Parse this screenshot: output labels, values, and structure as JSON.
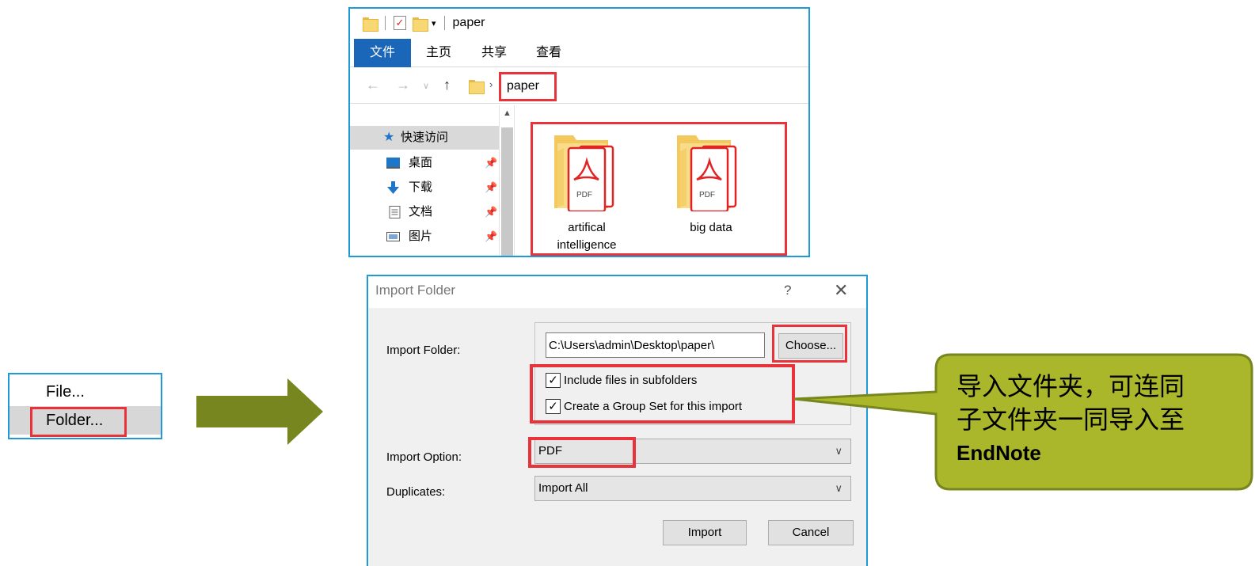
{
  "file_menu": {
    "items": [
      {
        "label": "File..."
      },
      {
        "label": "Folder..."
      }
    ]
  },
  "explorer": {
    "title": "paper",
    "ribbon_tabs": [
      "文件",
      "主页",
      "共享",
      "查看"
    ],
    "address": "paper",
    "sidebar": [
      {
        "label": "快速访问",
        "icon": "star-icon"
      },
      {
        "label": "桌面",
        "icon": "desktop-icon"
      },
      {
        "label": "下载",
        "icon": "download-icon"
      },
      {
        "label": "文档",
        "icon": "document-icon"
      },
      {
        "label": "图片",
        "icon": "picture-icon"
      }
    ],
    "folders": [
      {
        "name_line1": "artifical",
        "name_line2": "intelligence"
      },
      {
        "name_line1": "big data",
        "name_line2": ""
      }
    ]
  },
  "dialog": {
    "title": "Import Folder",
    "help": "?",
    "close": "✕",
    "import_folder_label": "Import Folder:",
    "import_folder_value": "C:\\Users\\admin\\Desktop\\paper\\",
    "choose_label": "Choose...",
    "include_subfolders_label": "Include files in subfolders",
    "include_subfolders_checked": true,
    "group_set_label": "Create a Group Set for this import",
    "group_set_checked": true,
    "import_option_label": "Import Option:",
    "import_option_value": "PDF",
    "duplicates_label": "Duplicates:",
    "duplicates_value": "Import All",
    "import_button": "Import",
    "cancel_button": "Cancel"
  },
  "callout": {
    "line1": "导入文件夹，可连同",
    "line2": "子文件夹一同导入至",
    "line3": "EndNote"
  },
  "colors": {
    "highlight": "#e8333a",
    "arrow": "#77861e",
    "callout_fill": "#aab72a",
    "window_border": "#1e9bd7",
    "ribbon_file_tab": "#1a66b8"
  }
}
